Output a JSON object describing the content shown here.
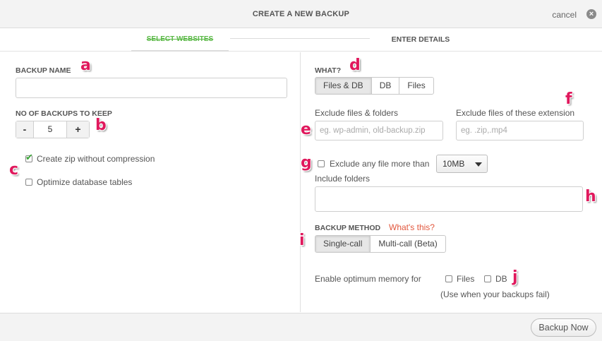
{
  "header": {
    "title": "CREATE A NEW BACKUP",
    "cancel_label": "cancel",
    "cancel_icon": "close-circle-icon"
  },
  "steps": {
    "step1": "SELECT WEBSITES",
    "step2": "ENTER DETAILS"
  },
  "left": {
    "backup_name_label": "BACKUP NAME",
    "backup_name_value": "",
    "keep_label": "NO OF BACKUPS TO KEEP",
    "minus_label": "-",
    "plus_label": "+",
    "keep_value": "5",
    "zip_label": "Create zip without compression",
    "zip_checked": true,
    "optimize_label": "Optimize database tables",
    "optimize_checked": false
  },
  "right": {
    "what_label": "WHAT?",
    "what_options": [
      "Files & DB",
      "DB",
      "Files"
    ],
    "what_selected": "Files & DB",
    "exclude_files_label": "Exclude files & folders",
    "exclude_files_placeholder": "eg. wp-admin, old-backup.zip",
    "exclude_ext_label": "Exclude files of these extension",
    "exclude_ext_placeholder": "eg. .zip,.mp4",
    "exclude_size_label": "Exclude any file more than",
    "exclude_size_value": "10MB",
    "include_folders_label": "Include folders",
    "method_label": "BACKUP METHOD",
    "whats_this": "What's this?",
    "method_options": [
      "Single-call",
      "Multi-call (Beta)"
    ],
    "method_selected": "Single-call",
    "memory_label": "Enable optimum memory for",
    "memory_files": "Files",
    "memory_db": "DB",
    "memory_note": "(Use when your backups fail)"
  },
  "annotations": {
    "a": "a",
    "b": "b",
    "c": "c",
    "d": "d",
    "e": "e",
    "f": "f",
    "g": "g",
    "h": "h",
    "i": "i",
    "j": "j"
  },
  "footer": {
    "backup_now": "Backup Now"
  },
  "colors": {
    "accent_green": "#59b845",
    "link_orange": "#e2583e",
    "annotation_pink": "#e0195d"
  }
}
